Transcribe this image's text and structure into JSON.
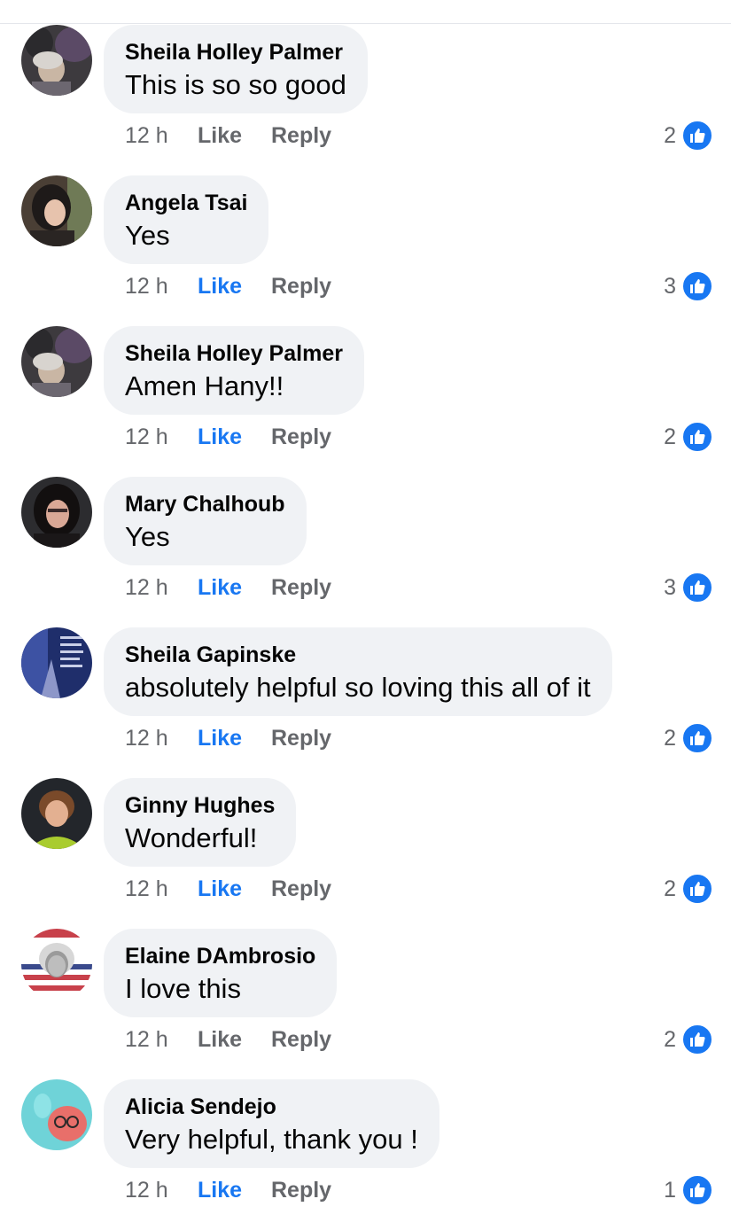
{
  "comments": [
    {
      "author": "Sheila Holley Palmer",
      "text": "This is so so good",
      "time": "12 h",
      "like_label": "Like",
      "liked": false,
      "reply_label": "Reply",
      "reactions": "2",
      "avatar": "avatar-photo-sheila-holley-palmer"
    },
    {
      "author": "Angela Tsai",
      "text": "Yes",
      "time": "12 h",
      "like_label": "Like",
      "liked": true,
      "reply_label": "Reply",
      "reactions": "3",
      "avatar": "avatar-photo-angela-tsai"
    },
    {
      "author": "Sheila Holley Palmer",
      "text": "Amen Hany!!",
      "time": "12 h",
      "like_label": "Like",
      "liked": true,
      "reply_label": "Reply",
      "reactions": "2",
      "avatar": "avatar-photo-sheila-holley-palmer"
    },
    {
      "author": "Mary Chalhoub",
      "text": "Yes",
      "time": "12 h",
      "like_label": "Like",
      "liked": true,
      "reply_label": "Reply",
      "reactions": "3",
      "avatar": "avatar-photo-mary-chalhoub"
    },
    {
      "author": "Sheila Gapinske",
      "text": "absolutely helpful so loving this all of it",
      "time": "12 h",
      "like_label": "Like",
      "liked": true,
      "reply_label": "Reply",
      "reactions": "2",
      "avatar": "avatar-photo-sheila-gapinske"
    },
    {
      "author": "Ginny Hughes",
      "text": "Wonderful!",
      "time": "12 h",
      "like_label": "Like",
      "liked": true,
      "reply_label": "Reply",
      "reactions": "2",
      "avatar": "avatar-photo-ginny-hughes"
    },
    {
      "author": "Elaine DAmbrosio",
      "text": "I love this",
      "time": "12 h",
      "like_label": "Like",
      "liked": false,
      "reply_label": "Reply",
      "reactions": "2",
      "avatar": "avatar-photo-elaine-dambrosio"
    },
    {
      "author": "Alicia Sendejo",
      "text": "Very helpful, thank you !",
      "time": "12 h",
      "like_label": "Like",
      "liked": true,
      "reply_label": "Reply",
      "reactions": "1",
      "avatar": "avatar-photo-alicia-sendejo"
    }
  ],
  "colors": {
    "accent": "#1877f2",
    "bubble": "#f0f2f5",
    "meta_text": "#65676b",
    "text": "#050505"
  }
}
